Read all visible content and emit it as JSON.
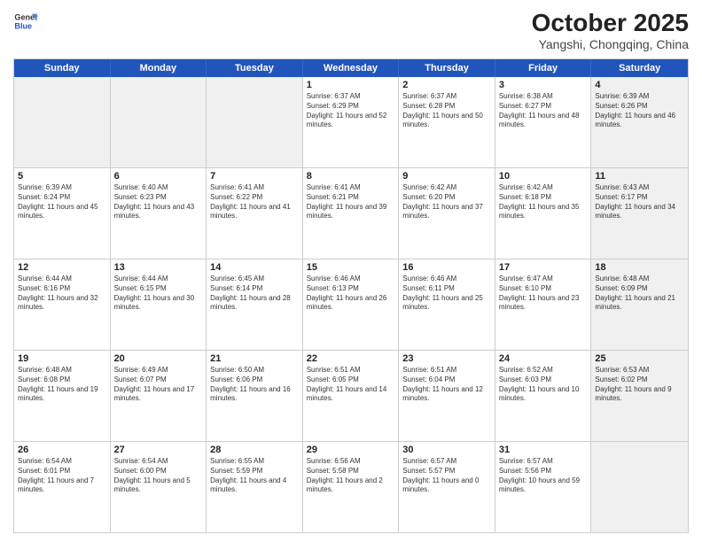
{
  "header": {
    "logo_general": "General",
    "logo_blue": "Blue",
    "month_year": "October 2025",
    "location": "Yangshi, Chongqing, China"
  },
  "days_of_week": [
    "Sunday",
    "Monday",
    "Tuesday",
    "Wednesday",
    "Thursday",
    "Friday",
    "Saturday"
  ],
  "weeks": [
    [
      {
        "day": "",
        "info": "",
        "shaded": true
      },
      {
        "day": "",
        "info": "",
        "shaded": true
      },
      {
        "day": "",
        "info": "",
        "shaded": true
      },
      {
        "day": "1",
        "info": "Sunrise: 6:37 AM\nSunset: 6:29 PM\nDaylight: 11 hours and 52 minutes."
      },
      {
        "day": "2",
        "info": "Sunrise: 6:37 AM\nSunset: 6:28 PM\nDaylight: 11 hours and 50 minutes."
      },
      {
        "day": "3",
        "info": "Sunrise: 6:38 AM\nSunset: 6:27 PM\nDaylight: 11 hours and 48 minutes."
      },
      {
        "day": "4",
        "info": "Sunrise: 6:39 AM\nSunset: 6:26 PM\nDaylight: 11 hours and 46 minutes.",
        "shaded": true
      }
    ],
    [
      {
        "day": "5",
        "info": "Sunrise: 6:39 AM\nSunset: 6:24 PM\nDaylight: 11 hours and 45 minutes."
      },
      {
        "day": "6",
        "info": "Sunrise: 6:40 AM\nSunset: 6:23 PM\nDaylight: 11 hours and 43 minutes."
      },
      {
        "day": "7",
        "info": "Sunrise: 6:41 AM\nSunset: 6:22 PM\nDaylight: 11 hours and 41 minutes."
      },
      {
        "day": "8",
        "info": "Sunrise: 6:41 AM\nSunset: 6:21 PM\nDaylight: 11 hours and 39 minutes."
      },
      {
        "day": "9",
        "info": "Sunrise: 6:42 AM\nSunset: 6:20 PM\nDaylight: 11 hours and 37 minutes."
      },
      {
        "day": "10",
        "info": "Sunrise: 6:42 AM\nSunset: 6:18 PM\nDaylight: 11 hours and 35 minutes."
      },
      {
        "day": "11",
        "info": "Sunrise: 6:43 AM\nSunset: 6:17 PM\nDaylight: 11 hours and 34 minutes.",
        "shaded": true
      }
    ],
    [
      {
        "day": "12",
        "info": "Sunrise: 6:44 AM\nSunset: 6:16 PM\nDaylight: 11 hours and 32 minutes."
      },
      {
        "day": "13",
        "info": "Sunrise: 6:44 AM\nSunset: 6:15 PM\nDaylight: 11 hours and 30 minutes."
      },
      {
        "day": "14",
        "info": "Sunrise: 6:45 AM\nSunset: 6:14 PM\nDaylight: 11 hours and 28 minutes."
      },
      {
        "day": "15",
        "info": "Sunrise: 6:46 AM\nSunset: 6:13 PM\nDaylight: 11 hours and 26 minutes."
      },
      {
        "day": "16",
        "info": "Sunrise: 6:46 AM\nSunset: 6:11 PM\nDaylight: 11 hours and 25 minutes."
      },
      {
        "day": "17",
        "info": "Sunrise: 6:47 AM\nSunset: 6:10 PM\nDaylight: 11 hours and 23 minutes."
      },
      {
        "day": "18",
        "info": "Sunrise: 6:48 AM\nSunset: 6:09 PM\nDaylight: 11 hours and 21 minutes.",
        "shaded": true
      }
    ],
    [
      {
        "day": "19",
        "info": "Sunrise: 6:48 AM\nSunset: 6:08 PM\nDaylight: 11 hours and 19 minutes."
      },
      {
        "day": "20",
        "info": "Sunrise: 6:49 AM\nSunset: 6:07 PM\nDaylight: 11 hours and 17 minutes."
      },
      {
        "day": "21",
        "info": "Sunrise: 6:50 AM\nSunset: 6:06 PM\nDaylight: 11 hours and 16 minutes."
      },
      {
        "day": "22",
        "info": "Sunrise: 6:51 AM\nSunset: 6:05 PM\nDaylight: 11 hours and 14 minutes."
      },
      {
        "day": "23",
        "info": "Sunrise: 6:51 AM\nSunset: 6:04 PM\nDaylight: 11 hours and 12 minutes."
      },
      {
        "day": "24",
        "info": "Sunrise: 6:52 AM\nSunset: 6:03 PM\nDaylight: 11 hours and 10 minutes."
      },
      {
        "day": "25",
        "info": "Sunrise: 6:53 AM\nSunset: 6:02 PM\nDaylight: 11 hours and 9 minutes.",
        "shaded": true
      }
    ],
    [
      {
        "day": "26",
        "info": "Sunrise: 6:54 AM\nSunset: 6:01 PM\nDaylight: 11 hours and 7 minutes."
      },
      {
        "day": "27",
        "info": "Sunrise: 6:54 AM\nSunset: 6:00 PM\nDaylight: 11 hours and 5 minutes."
      },
      {
        "day": "28",
        "info": "Sunrise: 6:55 AM\nSunset: 5:59 PM\nDaylight: 11 hours and 4 minutes."
      },
      {
        "day": "29",
        "info": "Sunrise: 6:56 AM\nSunset: 5:58 PM\nDaylight: 11 hours and 2 minutes."
      },
      {
        "day": "30",
        "info": "Sunrise: 6:57 AM\nSunset: 5:57 PM\nDaylight: 11 hours and 0 minutes."
      },
      {
        "day": "31",
        "info": "Sunrise: 6:57 AM\nSunset: 5:56 PM\nDaylight: 10 hours and 59 minutes."
      },
      {
        "day": "",
        "info": "",
        "shaded": true
      }
    ]
  ]
}
